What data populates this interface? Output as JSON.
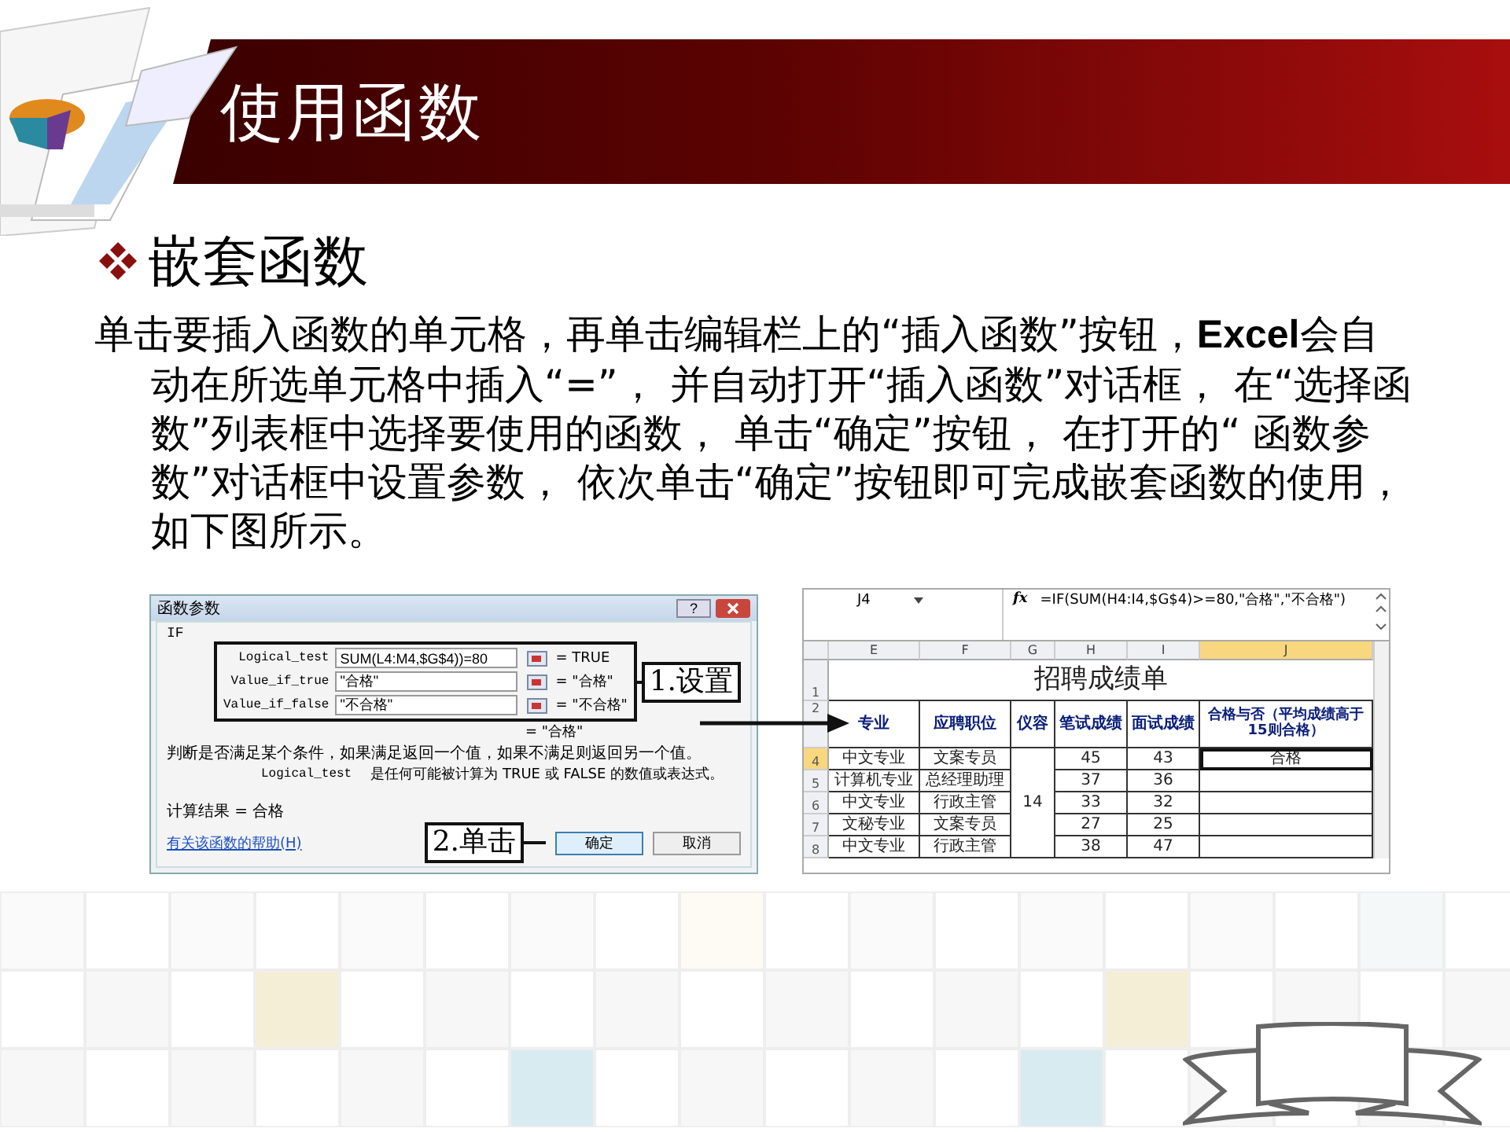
{
  "slide_title": "使用函数",
  "section_heading": "嵌套函数",
  "body_text": "单击要插入函数的单元格，再单击编辑栏上的“插入函数”按钮，**Excel**会自动在所选单元格中插入“=”， 并自动打开“插入函数”对话框， 在“选择函数”列表框中选择要使用的函数， 单击“确定”按钮， 在打开的“ 函数参数”对话框中设置参数， 依次单击“确定”按钮即可完成嵌套函数的使用，如下图所示。",
  "dialog": {
    "title": "函数参数",
    "help_button": "?",
    "group": "IF",
    "arguments": [
      {
        "label": "Logical_test",
        "value": "SUM(L4:M4,$G$4))=80",
        "result": "= TRUE"
      },
      {
        "label": "Value_if_true",
        "value": "\"合格\"",
        "result": "= \"合格\""
      },
      {
        "label": "Value_if_false",
        "value": "\"不合格\"",
        "result": "= \"不合格\""
      }
    ],
    "overall_result": "= \"合格\"",
    "description": "判断是否满足某个条件，如果满足返回一个值，如果不满足则返回另一个值。",
    "argument_help": {
      "name": "Logical_test",
      "text": "是任何可能被计算为 TRUE 或 FALSE 的数值或表达式。"
    },
    "formula_result": "计算结果 = 合格",
    "help_link": "有关该函数的帮助(H)",
    "buttons": [
      {
        "label": "确定",
        "default": true
      },
      {
        "label": "取消",
        "default": false
      }
    ]
  },
  "annotations": [
    {
      "text": "1.设置"
    },
    {
      "text": "2.单击"
    }
  ],
  "spreadsheet": {
    "name_box": "J4",
    "fx_label": "fx",
    "formula": "=IF(SUM(H4:I4,$G$4)>=80,\"合格\",\"不合格\")",
    "columns": [
      {
        "letter": "E",
        "selected": false
      },
      {
        "letter": "F",
        "selected": false
      },
      {
        "letter": "G",
        "selected": false
      },
      {
        "letter": "H",
        "selected": false
      },
      {
        "letter": "I",
        "selected": false
      },
      {
        "letter": "J",
        "selected": true
      }
    ],
    "title_row": "1",
    "title": "招聘成绩单",
    "header_row": "2",
    "headers": [
      "专业",
      "应聘职位",
      "仪容",
      "笔试成绩",
      "面试成绩",
      "合格与否（平均成绩高于15则合格）"
    ],
    "merged_score": "14",
    "rows": [
      {
        "row": "4",
        "selected": true,
        "major": "中文专业",
        "position": "文案专员",
        "written": "45",
        "interview": "43",
        "result": "合格"
      },
      {
        "row": "5",
        "selected": false,
        "major": "计算机专业",
        "position": "总经理助理",
        "written": "37",
        "interview": "36"
      },
      {
        "row": "6",
        "selected": false,
        "major": "中文专业",
        "position": "行政主管",
        "written": "33",
        "interview": "32"
      },
      {
        "row": "7",
        "selected": false,
        "major": "文秘专业",
        "position": "文案专员",
        "written": "27",
        "interview": "25"
      },
      {
        "row": "8",
        "selected": false,
        "major": "中文专业",
        "position": "行政主管",
        "written": "38",
        "interview": "47"
      }
    ]
  }
}
